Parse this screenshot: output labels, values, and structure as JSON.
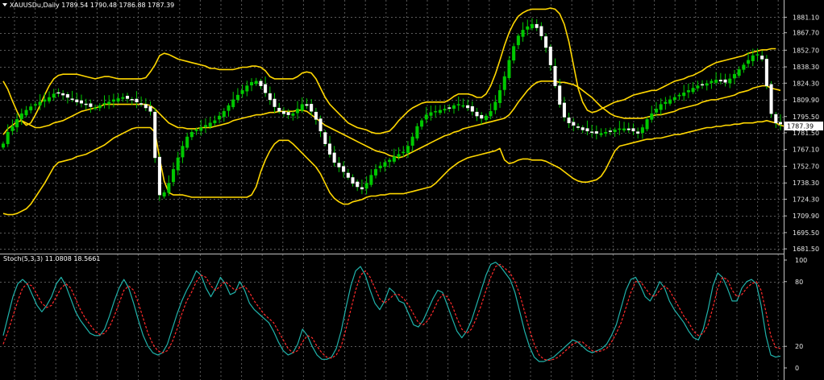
{
  "header": {
    "symbol_line": "XAUUSDu,Daily  1789.54 1790.48 1786.88 1787.39",
    "menu_icon": "triangle-down-icon"
  },
  "stoch_label": "Stoch(5,3,3) 11.0808 18.5661",
  "current_price_label": "1787.39",
  "colors": {
    "background": "#000000",
    "grid": "#5a5a5a",
    "candle": "#00c800",
    "doji": "#ffffff",
    "bands": "#ffd700",
    "stoch_main": "#20b2aa",
    "stoch_signal": "#ff2a2a",
    "separator": "#c0c0c0",
    "price_tag": "#ffffff"
  },
  "chart_data": [
    {
      "type": "candlestick",
      "pane": "price",
      "indicator": "Bollinger Bands",
      "y_ticks": [
        "1881.10",
        "1867.70",
        "1852.70",
        "1838.30",
        "1824.30",
        "1809.90",
        "1795.50",
        "1781.50",
        "1767.10",
        "1752.70",
        "1738.30",
        "1724.30",
        "1709.90",
        "1695.50",
        "1681.50"
      ],
      "y_tick_values": [
        1881.1,
        1867.7,
        1852.7,
        1838.3,
        1824.3,
        1809.9,
        1795.5,
        1781.5,
        1767.1,
        1752.7,
        1738.3,
        1724.3,
        1709.9,
        1695.5,
        1681.5
      ],
      "ylim": [
        1679.5,
        1889.0
      ],
      "close": [
        1772,
        1782,
        1787,
        1793,
        1798,
        1801,
        1804,
        1806,
        1808,
        1810,
        1812,
        1815,
        1816,
        1814,
        1812,
        1810,
        1808,
        1807,
        1806,
        1804,
        1803,
        1805,
        1807,
        1808,
        1810,
        1811,
        1812,
        1811,
        1810,
        1808,
        1806,
        1803,
        1800,
        1760,
        1728,
        1730,
        1738,
        1750,
        1760,
        1770,
        1778,
        1782,
        1784,
        1786,
        1788,
        1790,
        1792,
        1796,
        1800,
        1805,
        1810,
        1814,
        1818,
        1822,
        1825,
        1826,
        1822,
        1816,
        1810,
        1804,
        1800,
        1798,
        1797,
        1798,
        1802,
        1806,
        1805,
        1800,
        1793,
        1783,
        1772,
        1763,
        1756,
        1752,
        1748,
        1743,
        1738,
        1735,
        1733,
        1738,
        1745,
        1750,
        1753,
        1756,
        1758,
        1761,
        1763,
        1765,
        1770,
        1778,
        1787,
        1792,
        1797,
        1799,
        1800,
        1801,
        1802,
        1803,
        1805,
        1806,
        1805,
        1803,
        1800,
        1796,
        1794,
        1796,
        1800,
        1808,
        1818,
        1830,
        1844,
        1856,
        1865,
        1870,
        1873,
        1875,
        1872,
        1865,
        1855,
        1840,
        1822,
        1806,
        1795,
        1790,
        1788,
        1786,
        1784,
        1783,
        1782,
        1781,
        1781,
        1782,
        1783,
        1784,
        1785,
        1785,
        1784,
        1783,
        1781,
        1786,
        1793,
        1798,
        1802,
        1806,
        1808,
        1810,
        1812,
        1814,
        1816,
        1818,
        1820,
        1822,
        1823,
        1824,
        1826,
        1827,
        1826,
        1825,
        1828,
        1832,
        1836,
        1840,
        1844,
        1848,
        1849,
        1845,
        1822,
        1798,
        1790,
        1789
      ],
      "bb_upper": [
        1826,
        1819,
        1809,
        1800,
        1792,
        1788,
        1790,
        1797,
        1805,
        1814,
        1822,
        1828,
        1831,
        1832,
        1832,
        1832,
        1832,
        1831,
        1830,
        1829,
        1828,
        1829,
        1830,
        1830,
        1829,
        1828,
        1828,
        1828,
        1828,
        1828,
        1828,
        1829,
        1834,
        1840,
        1848,
        1850,
        1849,
        1847,
        1845,
        1844,
        1843,
        1842,
        1841,
        1840,
        1839,
        1837,
        1837,
        1836,
        1836,
        1836,
        1836,
        1837,
        1838,
        1838,
        1839,
        1839,
        1838,
        1835,
        1830,
        1828,
        1828,
        1828,
        1828,
        1828,
        1830,
        1833,
        1834,
        1833,
        1828,
        1820,
        1812,
        1806,
        1802,
        1798,
        1794,
        1790,
        1788,
        1786,
        1785,
        1784,
        1782,
        1781,
        1781,
        1782,
        1783,
        1787,
        1792,
        1796,
        1800,
        1803,
        1805,
        1807,
        1808,
        1808,
        1808,
        1808,
        1808,
        1810,
        1813,
        1815,
        1815,
        1815,
        1814,
        1812,
        1812,
        1815,
        1822,
        1832,
        1844,
        1857,
        1868,
        1876,
        1882,
        1885,
        1887,
        1888,
        1888,
        1888,
        1888,
        1889,
        1888,
        1884,
        1875,
        1860,
        1840,
        1820,
        1808,
        1801,
        1799,
        1800,
        1802,
        1804,
        1806,
        1808,
        1809,
        1810,
        1812,
        1814,
        1815,
        1816,
        1817,
        1818,
        1818,
        1820,
        1822,
        1824,
        1826,
        1827,
        1828,
        1830,
        1831,
        1833,
        1835,
        1838,
        1840,
        1842,
        1843,
        1844,
        1845,
        1846,
        1847,
        1848,
        1850,
        1851,
        1852,
        1853,
        1853,
        1854,
        1854
      ],
      "bb_middle": [
        1780,
        1785,
        1788,
        1791,
        1792,
        1790,
        1788,
        1786,
        1786,
        1787,
        1788,
        1790,
        1791,
        1792,
        1794,
        1796,
        1798,
        1800,
        1801,
        1802,
        1803,
        1804,
        1806,
        1806,
        1806,
        1806,
        1806,
        1806,
        1806,
        1806,
        1806,
        1806,
        1805,
        1802,
        1798,
        1794,
        1790,
        1788,
        1786,
        1786,
        1785,
        1785,
        1785,
        1786,
        1786,
        1786,
        1787,
        1788,
        1789,
        1790,
        1792,
        1793,
        1794,
        1795,
        1796,
        1797,
        1797,
        1798,
        1799,
        1799,
        1800,
        1800,
        1800,
        1800,
        1801,
        1801,
        1800,
        1797,
        1794,
        1791,
        1788,
        1786,
        1784,
        1782,
        1780,
        1778,
        1776,
        1774,
        1772,
        1770,
        1768,
        1766,
        1765,
        1764,
        1762,
        1761,
        1760,
        1761,
        1763,
        1765,
        1767,
        1769,
        1771,
        1773,
        1775,
        1777,
        1779,
        1780,
        1782,
        1783,
        1785,
        1786,
        1787,
        1788,
        1789,
        1790,
        1791,
        1792,
        1793,
        1794,
        1797,
        1802,
        1808,
        1813,
        1818,
        1822,
        1825,
        1826,
        1826,
        1826,
        1826,
        1825,
        1825,
        1824,
        1823,
        1821,
        1818,
        1815,
        1812,
        1808,
        1804,
        1801,
        1798,
        1796,
        1795,
        1794,
        1794,
        1794,
        1794,
        1794,
        1795,
        1796,
        1797,
        1797,
        1798,
        1799,
        1800,
        1802,
        1803,
        1804,
        1805,
        1806,
        1808,
        1809,
        1810,
        1810,
        1811,
        1812,
        1813,
        1814,
        1816,
        1817,
        1818,
        1820,
        1821,
        1822,
        1822,
        1820,
        1819,
        1818
      ],
      "bb_lower": [
        1712,
        1711,
        1711,
        1712,
        1714,
        1716,
        1720,
        1726,
        1732,
        1738,
        1745,
        1752,
        1756,
        1757,
        1758,
        1759,
        1761,
        1762,
        1763,
        1765,
        1767,
        1769,
        1771,
        1774,
        1777,
        1779,
        1781,
        1783,
        1785,
        1786,
        1786,
        1786,
        1786,
        1782,
        1760,
        1740,
        1730,
        1728,
        1728,
        1728,
        1727,
        1726,
        1726,
        1726,
        1726,
        1726,
        1726,
        1726,
        1726,
        1726,
        1726,
        1726,
        1726,
        1726,
        1728,
        1735,
        1748,
        1758,
        1766,
        1772,
        1775,
        1775,
        1775,
        1772,
        1768,
        1764,
        1760,
        1756,
        1752,
        1746,
        1738,
        1730,
        1725,
        1722,
        1720,
        1720,
        1722,
        1723,
        1724,
        1726,
        1727,
        1727,
        1728,
        1728,
        1729,
        1729,
        1729,
        1729,
        1730,
        1731,
        1732,
        1733,
        1734,
        1735,
        1738,
        1742,
        1746,
        1750,
        1753,
        1756,
        1758,
        1760,
        1761,
        1762,
        1763,
        1764,
        1765,
        1766,
        1768,
        1758,
        1755,
        1756,
        1758,
        1759,
        1759,
        1758,
        1758,
        1758,
        1757,
        1755,
        1753,
        1751,
        1748,
        1745,
        1742,
        1740,
        1739,
        1739,
        1740,
        1741,
        1744,
        1750,
        1758,
        1766,
        1770,
        1771,
        1772,
        1773,
        1774,
        1775,
        1776,
        1776,
        1777,
        1777,
        1778,
        1779,
        1780,
        1780,
        1781,
        1782,
        1783,
        1784,
        1785,
        1786,
        1786,
        1787,
        1787,
        1788,
        1788,
        1789,
        1789,
        1790,
        1790,
        1790,
        1791,
        1791,
        1792,
        1791,
        1790,
        1788,
        1787,
        1786
      ]
    },
    {
      "type": "line",
      "pane": "stochastic",
      "title": "Stoch(5,3,3) 11.0808 18.5661",
      "y_ticks": [
        "100",
        "80",
        "20",
        "0"
      ],
      "y_tick_values": [
        100,
        80,
        20,
        0
      ],
      "ylim": [
        0,
        100
      ],
      "series": [
        {
          "values": [
            30,
            48,
            66,
            78,
            82,
            78,
            68,
            58,
            52,
            58,
            66,
            78,
            84,
            76,
            64,
            52,
            44,
            38,
            32,
            30,
            30,
            36,
            48,
            62,
            74,
            82,
            74,
            60,
            44,
            30,
            20,
            14,
            12,
            14,
            22,
            36,
            50,
            62,
            72,
            80,
            90,
            86,
            74,
            66,
            74,
            84,
            78,
            68,
            70,
            80,
            72,
            60,
            54,
            50,
            46,
            42,
            34,
            24,
            16,
            12,
            14,
            22,
            36,
            30,
            20,
            12,
            8,
            8,
            10,
            18,
            34,
            56,
            76,
            90,
            94,
            86,
            72,
            60,
            54,
            62,
            74,
            70,
            62,
            60,
            50,
            40,
            38,
            44,
            54,
            64,
            72,
            70,
            58,
            46,
            34,
            28,
            34,
            44,
            58,
            72,
            86,
            96,
            98,
            94,
            88,
            82,
            70,
            52,
            34,
            20,
            10,
            6,
            6,
            8,
            10,
            14,
            18,
            22,
            26,
            24,
            20,
            16,
            14,
            16,
            18,
            22,
            30,
            40,
            56,
            72,
            82,
            84,
            76,
            66,
            62,
            70,
            80,
            74,
            62,
            54,
            48,
            42,
            34,
            28,
            26,
            36,
            54,
            76,
            88,
            84,
            74,
            62,
            62,
            74,
            80,
            82,
            78,
            58,
            30,
            12,
            10,
            11
          ],
          "color": "#20b2aa"
        },
        {
          "values": [
            22,
            34,
            48,
            62,
            74,
            78,
            76,
            68,
            60,
            56,
            58,
            66,
            74,
            78,
            74,
            64,
            54,
            46,
            40,
            34,
            31,
            32,
            38,
            48,
            60,
            72,
            76,
            72,
            60,
            46,
            32,
            22,
            16,
            14,
            16,
            24,
            36,
            50,
            62,
            70,
            80,
            86,
            84,
            76,
            72,
            76,
            80,
            76,
            72,
            74,
            76,
            70,
            62,
            56,
            50,
            46,
            42,
            34,
            26,
            18,
            14,
            16,
            24,
            30,
            28,
            20,
            14,
            10,
            9,
            12,
            20,
            36,
            54,
            72,
            86,
            90,
            84,
            74,
            64,
            60,
            64,
            68,
            68,
            64,
            58,
            50,
            42,
            40,
            44,
            52,
            62,
            68,
            66,
            58,
            46,
            36,
            32,
            36,
            46,
            58,
            72,
            84,
            94,
            96,
            92,
            88,
            80,
            68,
            52,
            36,
            22,
            12,
            8,
            7,
            8,
            10,
            14,
            18,
            22,
            24,
            24,
            20,
            16,
            15,
            16,
            18,
            24,
            32,
            42,
            56,
            70,
            80,
            80,
            74,
            68,
            66,
            72,
            76,
            72,
            64,
            56,
            48,
            42,
            34,
            30,
            32,
            40,
            56,
            74,
            84,
            82,
            72,
            66,
            68,
            74,
            78,
            80,
            72,
            52,
            30,
            19,
            18
          ],
          "color": "#ff2a2a",
          "dash": true
        }
      ]
    }
  ]
}
